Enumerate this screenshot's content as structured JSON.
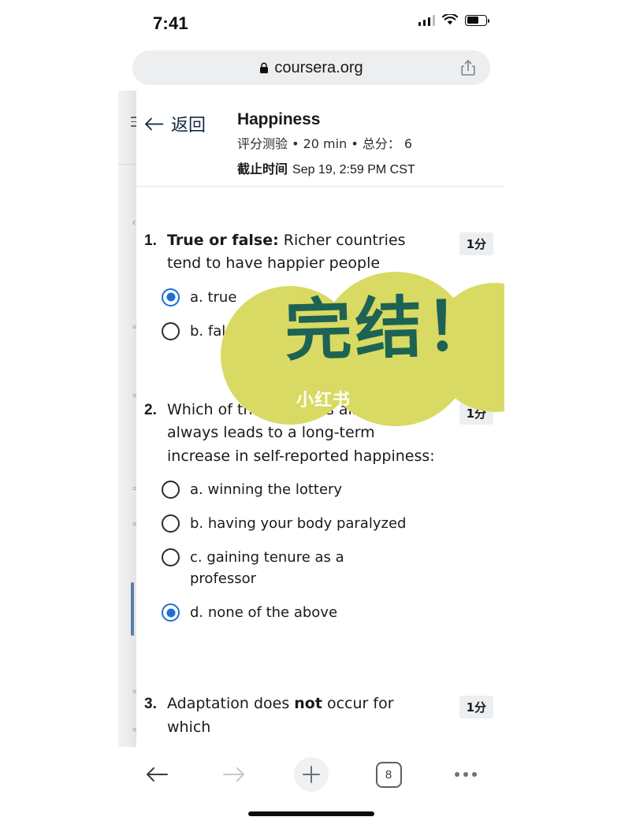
{
  "status_bar": {
    "time": "7:41",
    "signal_icon": "cellular-signal-icon",
    "wifi_icon": "wifi-icon",
    "battery_icon": "battery-icon",
    "battery_level_pct": 65
  },
  "browser": {
    "url": "coursera.org",
    "lock_icon": "lock-icon",
    "share_icon": "share-icon",
    "toolbar": {
      "back_label": "back",
      "forward_label": "forward",
      "new_tab_label": "new-tab",
      "tab_count": "8",
      "more_label": "more"
    }
  },
  "sidebar": {
    "menu_icon": "hamburger-menu-icon",
    "collapse_icon": "chevron-left-icon"
  },
  "quiz_header": {
    "back_label": "返回",
    "back_icon": "arrow-left-icon",
    "title": "Happiness",
    "subtitle": "评分测验 • 20 min • 总分： 6",
    "due_label": "截止时间",
    "due_value": "Sep 19, 2:59 PM CST"
  },
  "questions": [
    {
      "number": "1.",
      "prompt_bold": "True or false:",
      "prompt_rest": " Richer countries tend to have happier people",
      "points": "1分",
      "options": [
        {
          "label": "a. true",
          "selected": true
        },
        {
          "label": "b. false",
          "selected": false
        }
      ]
    },
    {
      "number": "2.",
      "prompt_bold": "",
      "prompt_rest": "Which of these events almost always leads to a long-term increase in self-reported happiness:",
      "points": "1分",
      "options": [
        {
          "label": "a. winning the lottery",
          "selected": false
        },
        {
          "label": "b. having your body paralyzed",
          "selected": false
        },
        {
          "label": "c. gaining tenure as a professor",
          "selected": false
        },
        {
          "label": "d. none of the above",
          "selected": true
        }
      ]
    },
    {
      "number": "3.",
      "prompt_bold": "not",
      "prompt_rest": "Adaptation does  occur for which",
      "prompt_prefix": "Adaptation does ",
      "prompt_suffix": " occur for which",
      "points": "1分",
      "options": []
    }
  ],
  "sticker": {
    "text": "完结！",
    "watermark": "小红书",
    "blob_color": "#d9da63",
    "text_color": "#1d6353"
  },
  "colors": {
    "accent_blue": "#1f6fd0",
    "link_navy": "#12293e",
    "badge_bg": "#eceff1",
    "url_bar_bg": "#eceef0"
  }
}
